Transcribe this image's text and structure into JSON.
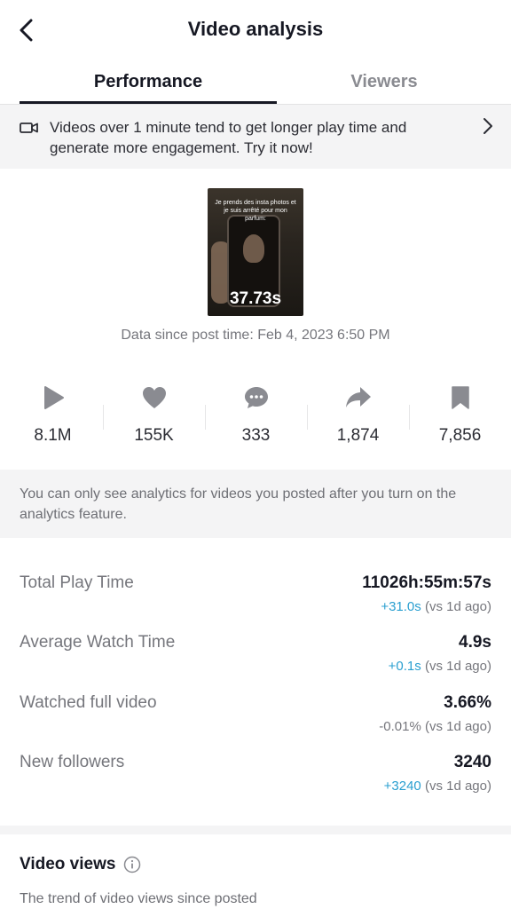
{
  "header": {
    "title": "Video analysis",
    "back_icon": "chevron-left-icon"
  },
  "tabs": [
    {
      "label": "Performance",
      "active": true
    },
    {
      "label": "Viewers",
      "active": false
    }
  ],
  "banner": {
    "icon": "video-camera-icon",
    "text": "Videos over 1 minute tend to get longer play time and generate more engagement. Try it now!"
  },
  "video": {
    "caption": "Je prends des insta photos et je suis arrêté pour mon parfum:",
    "duration": "37.73s"
  },
  "data_since": "Data since post time: Feb 4, 2023 6:50 PM",
  "stats": [
    {
      "icon": "play-icon",
      "value": "8.1M"
    },
    {
      "icon": "heart-icon",
      "value": "155K"
    },
    {
      "icon": "comment-icon",
      "value": "333"
    },
    {
      "icon": "share-icon",
      "value": "1,874"
    },
    {
      "icon": "bookmark-icon",
      "value": "7,856"
    }
  ],
  "notice": "You can only see analytics for videos you posted after you turn on the analytics feature.",
  "metrics": [
    {
      "label": "Total Play Time",
      "value": "11026h:55m:57s",
      "delta": "+31.0s",
      "delta_suffix": " (vs 1d ago)"
    },
    {
      "label": "Average Watch Time",
      "value": "4.9s",
      "delta": "+0.1s",
      "delta_suffix": " (vs 1d ago)"
    },
    {
      "label": "Watched full video",
      "value": "3.66%",
      "delta": "-0.01%",
      "delta_suffix": " (vs 1d ago)"
    },
    {
      "label": "New followers",
      "value": "3240",
      "delta": "+3240",
      "delta_suffix": " (vs 1d ago)"
    }
  ],
  "video_views": {
    "title": "Video views",
    "subtitle": "The trend of video views since posted"
  },
  "colors": {
    "positive": "#2a9fd0",
    "icon_gray": "#8a8b91",
    "panel_bg": "#f4f4f5"
  }
}
